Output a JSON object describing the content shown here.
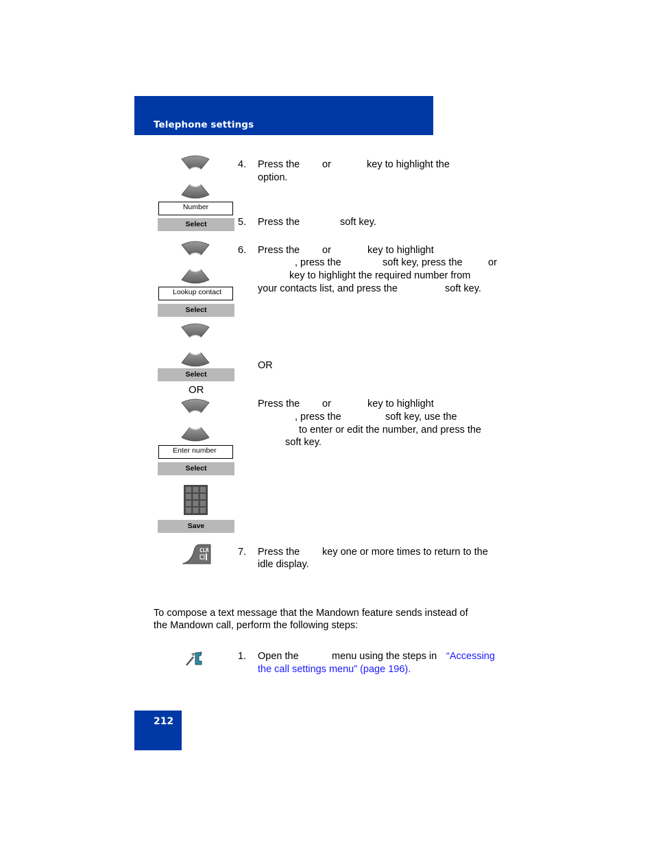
{
  "header": {
    "section_title": "Telephone settings"
  },
  "footer": {
    "page_number": "212"
  },
  "left_column": {
    "display_number": "Number",
    "softkey_select_1": "Select",
    "display_lookup": "Lookup contact",
    "softkey_select_2": "Select",
    "softkey_select_3": "Select",
    "or_label": "OR",
    "display_enter_number": "Enter number",
    "softkey_select_4": "Select",
    "softkey_save": "Save",
    "icons": [
      "up-navigation-key-icon",
      "down-navigation-key-icon",
      "keypad-icon",
      "clear-power-key-icon",
      "call-settings-tools-icon"
    ]
  },
  "steps": {
    "s4": {
      "num": "4.",
      "l1a": "Press the",
      "l1b": "or",
      "l1c": "key to highlight the",
      "l2": "option."
    },
    "s5": {
      "num": "5.",
      "l1a": "Press the",
      "l1b": "soft key."
    },
    "s6": {
      "num": "6.",
      "l1a": "Press the",
      "l1b": "or",
      "l1c": "key to highlight",
      "l2a": ", press the",
      "l2b": "soft key, press the",
      "l2c": "or",
      "l3": "key to highlight the required number from",
      "l4a": "your contacts list, and press the",
      "l4b": "soft key."
    },
    "or_label": "OR",
    "s6b": {
      "l1a": "Press the",
      "l1b": "or",
      "l1c": "key to highlight",
      "l2a": ", press the",
      "l2b": "soft key, use the",
      "l3": "to enter or edit the number, and press the",
      "l4": "soft key."
    },
    "s7": {
      "num": "7.",
      "l1a": "Press the",
      "l1b": "key one or more times to return to the",
      "l2": "idle display."
    }
  },
  "intro": {
    "l1": "To compose a text message that the Mandown feature sends instead of",
    "l2": "the Mandown call, perform the following steps:"
  },
  "step1": {
    "num": "1.",
    "l1a": "Open the",
    "l1b": "menu using the steps in",
    "link_l1": "“Accessing",
    "link_l2": "the call settings menu” (page 196)."
  },
  "colors": {
    "brand_blue": "#0039a6",
    "softkey_gray": "#b8b8b8",
    "link_blue": "#1a1aff"
  }
}
